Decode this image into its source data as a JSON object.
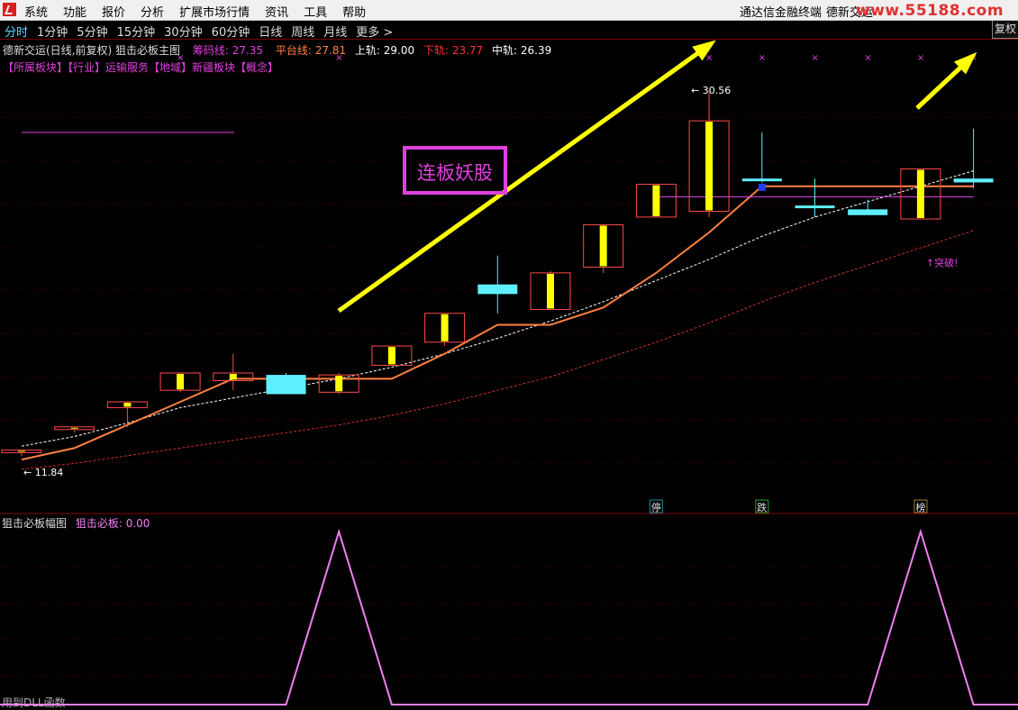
{
  "menu": {
    "items": [
      "系统",
      "功能",
      "报价",
      "分析",
      "扩展市场行情",
      "资讯",
      "工具",
      "帮助"
    ],
    "terminal": "通达信金融终端",
    "stock_name": "德新交运",
    "watermark": "www.55188.com"
  },
  "periods": [
    "分时",
    "1分钟",
    "5分钟",
    "15分钟",
    "30分钟",
    "60分钟",
    "日线",
    "周线",
    "月线",
    "更多 >"
  ],
  "active_period": "分时",
  "fuquan_button": "复权",
  "main_info": {
    "title": "德新交运(日线,前复权) 狙击必板主图",
    "chouma_label": "筹码线: ",
    "chouma_value": "27.35",
    "pingtai_label": "平台线: ",
    "pingtai_value": "27.81",
    "upper_label": "上轨: ",
    "upper_value": "29.00",
    "lower_label": "下轨: ",
    "lower_value": "23.77",
    "middle_label": "中轨: ",
    "middle_value": "26.39"
  },
  "sector_line": "【所属板块】【行业】运输服务【地域】新疆板块【概念】",
  "sub_info": {
    "title": "狙击必板幅图",
    "label": "狙击必板: ",
    "value": "0.00"
  },
  "bottom_note": "用到DLL函数",
  "colors": {
    "up_candle": "#ff4a4a",
    "body_fill": "#ffff00",
    "down_candle": "#5ff0ff",
    "platform_line": "#ff8040",
    "upper_band": "#ffffff",
    "lower_band": "#c83030",
    "magenta": "#e040e0",
    "arrow": "#ffff00",
    "indicator": "#f080f0"
  },
  "chart_data": {
    "type": "candlestick",
    "candles": [
      {
        "o": 11.8,
        "h": 11.9,
        "l": 11.6,
        "c": 11.9,
        "up": true
      },
      {
        "o": 13.0,
        "h": 13.1,
        "l": 12.8,
        "c": 13.1,
        "up": true
      },
      {
        "o": 14.1,
        "h": 14.2,
        "l": 13.1,
        "c": 14.4,
        "up": true
      },
      {
        "o": 15.0,
        "h": 15.0,
        "l": 14.9,
        "c": 15.9,
        "up": true
      },
      {
        "o": 15.5,
        "h": 16.9,
        "l": 15.0,
        "c": 15.9,
        "up": true
      },
      {
        "o": 15.8,
        "h": 15.9,
        "l": 14.9,
        "c": 14.8,
        "up": false
      },
      {
        "o": 14.9,
        "h": 15.9,
        "l": 14.8,
        "c": 15.8,
        "up": true
      },
      {
        "o": 16.3,
        "h": 17.3,
        "l": 16.3,
        "c": 17.3,
        "up": true
      },
      {
        "o": 17.5,
        "h": 19.0,
        "l": 17.3,
        "c": 19.0,
        "up": true
      },
      {
        "o": 20.5,
        "h": 22.0,
        "l": 19.0,
        "c": 20.0,
        "up": false
      },
      {
        "o": 19.2,
        "h": 21.2,
        "l": 19.2,
        "c": 21.1,
        "up": true
      },
      {
        "o": 21.4,
        "h": 23.3,
        "l": 21.1,
        "c": 23.6,
        "up": true
      },
      {
        "o": 24.0,
        "h": 25.7,
        "l": 24.0,
        "c": 25.7,
        "up": true
      },
      {
        "o": 24.3,
        "h": 30.56,
        "l": 24.0,
        "c": 29.0,
        "up": true
      },
      {
        "o": 26.0,
        "h": 28.4,
        "l": 25.8,
        "c": 25.9,
        "up": false
      },
      {
        "o": 24.6,
        "h": 26.0,
        "l": 24.0,
        "c": 24.6,
        "up": false
      },
      {
        "o": 24.4,
        "h": 24.9,
        "l": 24.2,
        "c": 24.1,
        "up": false
      },
      {
        "o": 23.9,
        "h": 26.5,
        "l": 23.9,
        "c": 26.5,
        "up": true
      },
      {
        "o": 26.0,
        "h": 28.6,
        "l": 25.5,
        "c": 25.8,
        "up": false
      }
    ],
    "platform_line": [
      11.4,
      12.0,
      13.2,
      14.4,
      15.6,
      15.6,
      15.6,
      15.6,
      16.9,
      18.4,
      18.4,
      19.3,
      21.1,
      23.2,
      25.6,
      25.6,
      25.6,
      25.6,
      25.6
    ],
    "upper_band": [
      12.1,
      12.6,
      13.3,
      14.1,
      14.6,
      15.1,
      15.6,
      16.2,
      16.9,
      17.7,
      18.6,
      19.6,
      20.7,
      21.8,
      23.0,
      24.0,
      24.8,
      25.6,
      26.4
    ],
    "middle_band": [
      11.6,
      12.0,
      12.6,
      13.4,
      14.0,
      14.5,
      15.0,
      15.6,
      16.3,
      17.1,
      18.0,
      19.1,
      20.2,
      21.3,
      22.5,
      23.5,
      24.3,
      25.1,
      25.9
    ],
    "lower_band": [
      10.9,
      11.2,
      11.6,
      12.0,
      12.4,
      12.8,
      13.2,
      13.7,
      14.3,
      15.0,
      15.7,
      16.6,
      17.5,
      18.5,
      19.6,
      20.6,
      21.5,
      22.4,
      23.3
    ],
    "magenta_hline": {
      "from": 12,
      "to": 18,
      "value": 25.05
    },
    "pivot_mark": {
      "index": 14,
      "value": 25.55
    },
    "annotations": [
      {
        "text": "11.84",
        "type": "low"
      },
      {
        "text": "30.56",
        "type": "high"
      },
      {
        "text": "突破!",
        "type": "breakout"
      }
    ],
    "headline_label": "连板妖股",
    "markers": [
      {
        "text": "停",
        "index": 12
      },
      {
        "text": "跌",
        "index": 14
      },
      {
        "text": "榜",
        "index": 17
      }
    ],
    "x_markers": [
      3,
      6,
      13,
      14,
      15,
      16,
      17,
      18
    ],
    "indicator": [
      0,
      0,
      0,
      0,
      0,
      0,
      1,
      0,
      0,
      0,
      0,
      0,
      0,
      0,
      0,
      0,
      0,
      1,
      0
    ],
    "ylim": [
      10,
      32
    ]
  }
}
